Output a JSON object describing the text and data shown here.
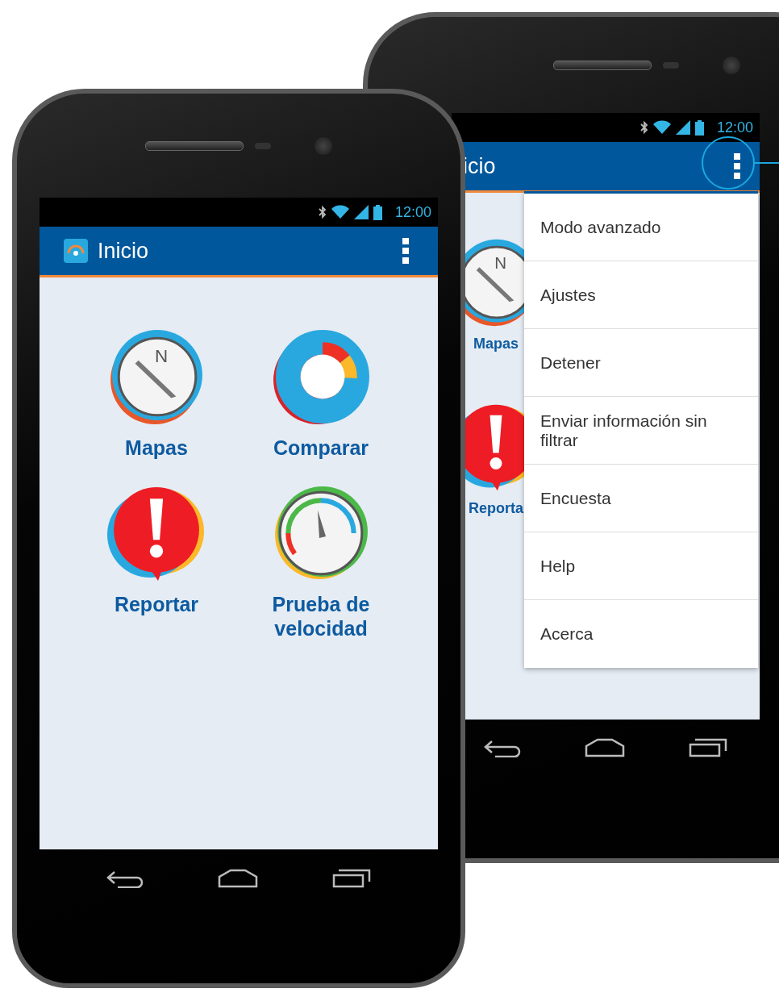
{
  "back_phone": {
    "status_bar": {
      "time": "12:00"
    },
    "app_bar": {
      "title": "icio"
    },
    "tiles": [
      {
        "kind": "compass",
        "mark": "N",
        "label": "Mapas"
      },
      {
        "kind": "alert",
        "label": "Reporta"
      }
    ],
    "overflow_menu": {
      "items": [
        "Modo avanzado",
        "Ajustes",
        "Detener",
        "Enviar información sin filtrar",
        "Encuesta",
        "Help",
        "Acerca"
      ]
    }
  },
  "front_phone": {
    "status_bar": {
      "time": "12:00"
    },
    "app_bar": {
      "title": "Inicio"
    },
    "tiles": [
      {
        "kind": "compass",
        "mark": "N",
        "label": "Mapas"
      },
      {
        "kind": "chart",
        "label": "Comparar"
      },
      {
        "kind": "alert",
        "label": "Reportar"
      },
      {
        "kind": "gauge",
        "label": "Prueba de velocidad"
      }
    ]
  }
}
